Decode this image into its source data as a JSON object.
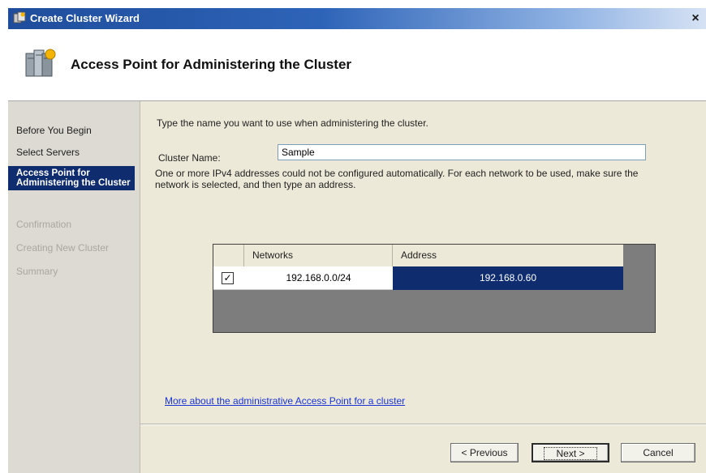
{
  "window": {
    "title": "Create Cluster Wizard",
    "close_glyph": "×",
    "title_icon": "cluster-wizard-icon"
  },
  "header": {
    "title": "Access Point for Administering the Cluster",
    "icon": "cluster-servers-icon"
  },
  "steps": [
    {
      "label": "Before You Begin",
      "state": "done"
    },
    {
      "label": "Select Servers",
      "state": "done"
    },
    {
      "label": "Access Point for Administering the Cluster",
      "state": "active"
    },
    {
      "label": "Confirmation",
      "state": "disabled"
    },
    {
      "label": "Creating New Cluster",
      "state": "disabled"
    },
    {
      "label": "Summary",
      "state": "disabled"
    }
  ],
  "content": {
    "instruction": "Type the name you want to use when administering the cluster.",
    "cluster_name_label": "Cluster Name:",
    "cluster_name_value": "Sample",
    "ipv4_note": "One or more IPv4 addresses could not be configured automatically.  For each network to be used, make sure the network is selected, and then type an address.",
    "grid": {
      "columns": [
        "Networks",
        "Address"
      ],
      "rows": [
        {
          "checked": true,
          "network": "192.168.0.0/24",
          "address": "192.168.0.60"
        }
      ]
    },
    "help_link": "More about the administrative Access Point for a cluster"
  },
  "buttons": {
    "previous": "< Previous",
    "next": "Next >",
    "cancel": "Cancel"
  },
  "colors": {
    "selection": "#0f2d6e",
    "link": "#1a33d6"
  }
}
